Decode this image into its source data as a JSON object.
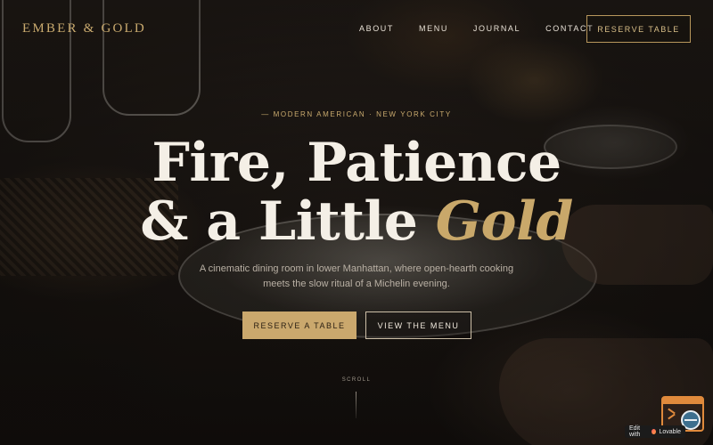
{
  "brand": {
    "name": "EMBER & GOLD"
  },
  "nav": {
    "links": [
      "ABOUT",
      "MENU",
      "JOURNAL",
      "CONTACT"
    ],
    "cta": "RESERVE TABLE"
  },
  "hero": {
    "eyebrow": "— MODERN AMERICAN · NEW YORK CITY",
    "headline_line1": "Fire, Patience",
    "headline_line2_prefix": "& a Little ",
    "headline_line2_accent": "Gold",
    "subtitle": "A cinematic dining room in lower Manhattan, where open-hearth cooking meets the slow ritual of a Michelin evening.",
    "primary_button": "RESERVE A TABLE",
    "secondary_button": "VIEW THE MENU",
    "scroll_label": "SCROLL"
  },
  "badge": {
    "text": "Edit with",
    "brand": "Lovable"
  },
  "colors": {
    "gold": "#c9a86a",
    "background": "#1d1814",
    "text": "#f4efe6"
  },
  "icons": {
    "widget": "browser-globe-icon"
  }
}
